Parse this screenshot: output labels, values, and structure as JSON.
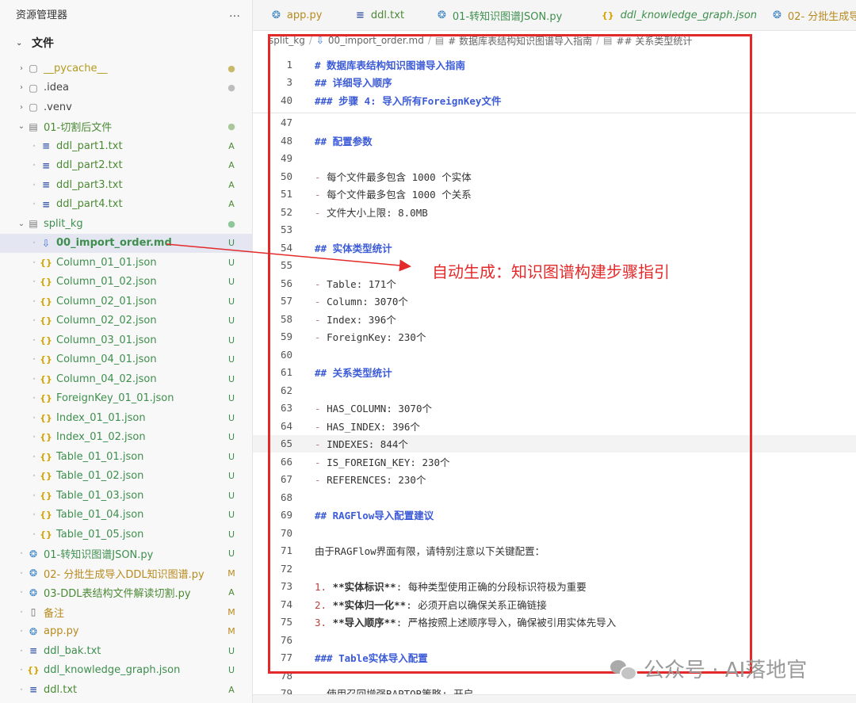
{
  "sidebar": {
    "title": "资源管理器",
    "more_icon": "…",
    "section_label": "文件",
    "tree": [
      {
        "depth": 0,
        "kind": "folder",
        "arrow": "›",
        "label": "__pycache__",
        "status": "●",
        "color": "#b59a1e",
        "status_color": "#c9b96a"
      },
      {
        "depth": 0,
        "kind": "folder",
        "arrow": "›",
        "label": ".idea",
        "status": "●",
        "color": "#444",
        "status_color": "#bdbdbd"
      },
      {
        "depth": 0,
        "kind": "folder",
        "arrow": "›",
        "label": ".venv",
        "status": "",
        "color": "#444",
        "status_color": "#bdbdbd"
      },
      {
        "depth": 0,
        "kind": "folder-open",
        "arrow": "⌄",
        "label": "01-切割后文件",
        "status": "●",
        "color": "#4b8a35",
        "status_color": "#a9c79a"
      },
      {
        "depth": 1,
        "kind": "txt",
        "label": "ddl_part1.txt",
        "status": "A",
        "color": "#4b8a35",
        "status_color": "#4b8a35"
      },
      {
        "depth": 1,
        "kind": "txt",
        "label": "ddl_part2.txt",
        "status": "A",
        "color": "#4b8a35",
        "status_color": "#4b8a35"
      },
      {
        "depth": 1,
        "kind": "txt",
        "label": "ddl_part3.txt",
        "status": "A",
        "color": "#4b8a35",
        "status_color": "#4b8a35"
      },
      {
        "depth": 1,
        "kind": "txt",
        "label": "ddl_part4.txt",
        "status": "A",
        "color": "#4b8a35",
        "status_color": "#4b8a35"
      },
      {
        "depth": 0,
        "kind": "folder-open",
        "arrow": "⌄",
        "label": "split_kg",
        "status": "●",
        "color": "#3e8f4e",
        "status_color": "#8fc79a"
      },
      {
        "depth": 1,
        "kind": "md",
        "label": "00_import_order.md",
        "status": "U",
        "color": "#3e8f4e",
        "status_color": "#3e8f4e",
        "selected": true
      },
      {
        "depth": 1,
        "kind": "json",
        "label": "Column_01_01.json",
        "status": "U",
        "color": "#3e8f4e",
        "status_color": "#3e8f4e"
      },
      {
        "depth": 1,
        "kind": "json",
        "label": "Column_01_02.json",
        "status": "U",
        "color": "#3e8f4e",
        "status_color": "#3e8f4e"
      },
      {
        "depth": 1,
        "kind": "json",
        "label": "Column_02_01.json",
        "status": "U",
        "color": "#3e8f4e",
        "status_color": "#3e8f4e"
      },
      {
        "depth": 1,
        "kind": "json",
        "label": "Column_02_02.json",
        "status": "U",
        "color": "#3e8f4e",
        "status_color": "#3e8f4e"
      },
      {
        "depth": 1,
        "kind": "json",
        "label": "Column_03_01.json",
        "status": "U",
        "color": "#3e8f4e",
        "status_color": "#3e8f4e"
      },
      {
        "depth": 1,
        "kind": "json",
        "label": "Column_04_01.json",
        "status": "U",
        "color": "#3e8f4e",
        "status_color": "#3e8f4e"
      },
      {
        "depth": 1,
        "kind": "json",
        "label": "Column_04_02.json",
        "status": "U",
        "color": "#3e8f4e",
        "status_color": "#3e8f4e"
      },
      {
        "depth": 1,
        "kind": "json",
        "label": "ForeignKey_01_01.json",
        "status": "U",
        "color": "#3e8f4e",
        "status_color": "#3e8f4e"
      },
      {
        "depth": 1,
        "kind": "json",
        "label": "Index_01_01.json",
        "status": "U",
        "color": "#3e8f4e",
        "status_color": "#3e8f4e"
      },
      {
        "depth": 1,
        "kind": "json",
        "label": "Index_01_02.json",
        "status": "U",
        "color": "#3e8f4e",
        "status_color": "#3e8f4e"
      },
      {
        "depth": 1,
        "kind": "json",
        "label": "Table_01_01.json",
        "status": "U",
        "color": "#3e8f4e",
        "status_color": "#3e8f4e"
      },
      {
        "depth": 1,
        "kind": "json",
        "label": "Table_01_02.json",
        "status": "U",
        "color": "#3e8f4e",
        "status_color": "#3e8f4e"
      },
      {
        "depth": 1,
        "kind": "json",
        "label": "Table_01_03.json",
        "status": "U",
        "color": "#3e8f4e",
        "status_color": "#3e8f4e"
      },
      {
        "depth": 1,
        "kind": "json",
        "label": "Table_01_04.json",
        "status": "U",
        "color": "#3e8f4e",
        "status_color": "#3e8f4e"
      },
      {
        "depth": 1,
        "kind": "json",
        "label": "Table_01_05.json",
        "status": "U",
        "color": "#3e8f4e",
        "status_color": "#3e8f4e"
      },
      {
        "depth": 0,
        "kind": "py",
        "label": "01-转知识图谱JSON.py",
        "status": "U",
        "color": "#3e8f4e",
        "status_color": "#3e8f4e"
      },
      {
        "depth": 0,
        "kind": "py",
        "label": "02- 分批生成导入DDL知识图谱.py",
        "status": "M",
        "color": "#b88a1e",
        "status_color": "#b88a1e"
      },
      {
        "depth": 0,
        "kind": "py",
        "label": "03-DDL表结构文件解读切割.py",
        "status": "A",
        "color": "#4b8a35",
        "status_color": "#4b8a35"
      },
      {
        "depth": 0,
        "kind": "doc",
        "label": "备注",
        "status": "M",
        "color": "#b88a1e",
        "status_color": "#b88a1e"
      },
      {
        "depth": 0,
        "kind": "py",
        "label": "app.py",
        "status": "M",
        "color": "#b88a1e",
        "status_color": "#b88a1e"
      },
      {
        "depth": 0,
        "kind": "txt",
        "label": "ddl_bak.txt",
        "status": "U",
        "color": "#3e8f4e",
        "status_color": "#3e8f4e"
      },
      {
        "depth": 0,
        "kind": "json",
        "label": "ddl_knowledge_graph.json",
        "status": "U",
        "color": "#3e8f4e",
        "status_color": "#3e8f4e"
      },
      {
        "depth": 0,
        "kind": "txt",
        "label": "ddl.txt",
        "status": "A",
        "color": "#4b8a35",
        "status_color": "#4b8a35"
      }
    ]
  },
  "tabs": [
    {
      "kind": "py",
      "label": "app.py",
      "color": "#b88a1e",
      "italic": false
    },
    {
      "kind": "txt",
      "label": "ddl.txt",
      "color": "#4b8a35",
      "italic": false
    },
    {
      "kind": "py",
      "label": "01-转知识图谱JSON.py",
      "color": "#3e8f4e",
      "italic": false
    },
    {
      "kind": "json",
      "label": "ddl_knowledge_graph.json",
      "color": "#3e8f4e",
      "italic": true
    },
    {
      "kind": "py",
      "label": "02- 分批生成导",
      "color": "#b88a1e",
      "italic": false
    }
  ],
  "breadcrumb": [
    {
      "icon": "",
      "text": "split_kg"
    },
    {
      "icon": "⇩",
      "text": "00_import_order.md"
    },
    {
      "icon": "▤",
      "text": "# 数据库表结构知识图谱导入指南"
    },
    {
      "icon": "▤",
      "text": "## 关系类型统计"
    }
  ],
  "editor": {
    "lines": [
      {
        "n": "1",
        "parts": [
          [
            "h",
            "# 数据库表结构知识图谱导入指南"
          ]
        ]
      },
      {
        "n": "3",
        "parts": [
          [
            "h",
            "## 详细导入顺序"
          ]
        ]
      },
      {
        "n": "40",
        "parts": [
          [
            "h",
            "### 步骤 4: 导入所有ForeignKey文件"
          ]
        ],
        "divider_after": true
      },
      {
        "n": "47",
        "parts": []
      },
      {
        "n": "48",
        "parts": [
          [
            "h",
            "## 配置参数"
          ]
        ]
      },
      {
        "n": "49",
        "parts": []
      },
      {
        "n": "50",
        "parts": [
          [
            "dash",
            "- "
          ],
          [
            "t",
            "每个文件最多包含 1000 个实体"
          ]
        ]
      },
      {
        "n": "51",
        "parts": [
          [
            "dash",
            "- "
          ],
          [
            "t",
            "每个文件最多包含 1000 个关系"
          ]
        ]
      },
      {
        "n": "52",
        "parts": [
          [
            "dash",
            "- "
          ],
          [
            "t",
            "文件大小上限: 8.0MB"
          ]
        ]
      },
      {
        "n": "53",
        "parts": []
      },
      {
        "n": "54",
        "parts": [
          [
            "h",
            "## 实体类型统计"
          ]
        ]
      },
      {
        "n": "55",
        "parts": []
      },
      {
        "n": "56",
        "parts": [
          [
            "dash",
            "- "
          ],
          [
            "t",
            "Table: 171个"
          ]
        ]
      },
      {
        "n": "57",
        "parts": [
          [
            "dash",
            "- "
          ],
          [
            "t",
            "Column: 3070个"
          ]
        ]
      },
      {
        "n": "58",
        "parts": [
          [
            "dash",
            "- "
          ],
          [
            "t",
            "Index: 396个"
          ]
        ]
      },
      {
        "n": "59",
        "parts": [
          [
            "dash",
            "- "
          ],
          [
            "t",
            "ForeignKey: 230个"
          ]
        ]
      },
      {
        "n": "60",
        "parts": []
      },
      {
        "n": "61",
        "parts": [
          [
            "h",
            "## 关系类型统计"
          ]
        ]
      },
      {
        "n": "62",
        "parts": []
      },
      {
        "n": "63",
        "parts": [
          [
            "dash",
            "- "
          ],
          [
            "t",
            "HAS_COLUMN: 3070个"
          ]
        ]
      },
      {
        "n": "64",
        "parts": [
          [
            "dash",
            "- "
          ],
          [
            "t",
            "HAS_INDEX: 396个"
          ]
        ]
      },
      {
        "n": "65",
        "parts": [
          [
            "dash",
            "- "
          ],
          [
            "t",
            "INDEXES: 844个"
          ]
        ],
        "highlight": true
      },
      {
        "n": "66",
        "parts": [
          [
            "dash",
            "- "
          ],
          [
            "t",
            "IS_FOREIGN_KEY: 230个"
          ]
        ]
      },
      {
        "n": "67",
        "parts": [
          [
            "dash",
            "- "
          ],
          [
            "t",
            "REFERENCES: 230个"
          ]
        ]
      },
      {
        "n": "68",
        "parts": []
      },
      {
        "n": "69",
        "parts": [
          [
            "h",
            "## RAGFlow导入配置建议"
          ]
        ]
      },
      {
        "n": "70",
        "parts": []
      },
      {
        "n": "71",
        "parts": [
          [
            "t",
            "由于RAGFlow界面有限，请特别注意以下关键配置："
          ]
        ]
      },
      {
        "n": "72",
        "parts": []
      },
      {
        "n": "73",
        "parts": [
          [
            "num",
            "1. "
          ],
          [
            "b",
            "**实体标识**"
          ],
          [
            "t",
            ": 每种类型使用正确的分段标识符极为重要"
          ]
        ]
      },
      {
        "n": "74",
        "parts": [
          [
            "num",
            "2. "
          ],
          [
            "b",
            "**实体归一化**"
          ],
          [
            "t",
            ": 必须开启以确保关系正确链接"
          ]
        ]
      },
      {
        "n": "75",
        "parts": [
          [
            "num",
            "3. "
          ],
          [
            "b",
            "**导入顺序**"
          ],
          [
            "t",
            ": 严格按照上述顺序导入，确保被引用实体先导入"
          ]
        ]
      },
      {
        "n": "76",
        "parts": []
      },
      {
        "n": "77",
        "parts": [
          [
            "h",
            "### Table实体导入配置"
          ]
        ]
      },
      {
        "n": "78",
        "parts": []
      },
      {
        "n": "79",
        "parts": [
          [
            "dash",
            "- "
          ],
          [
            "t",
            "使用召回增强RAPTOR策略: 开启"
          ]
        ]
      }
    ]
  },
  "annotation": {
    "text": "自动生成：知识图谱构建步骤指引",
    "color": "#e32a2a"
  },
  "watermark": {
    "text": "公众号 · AI落地官"
  }
}
